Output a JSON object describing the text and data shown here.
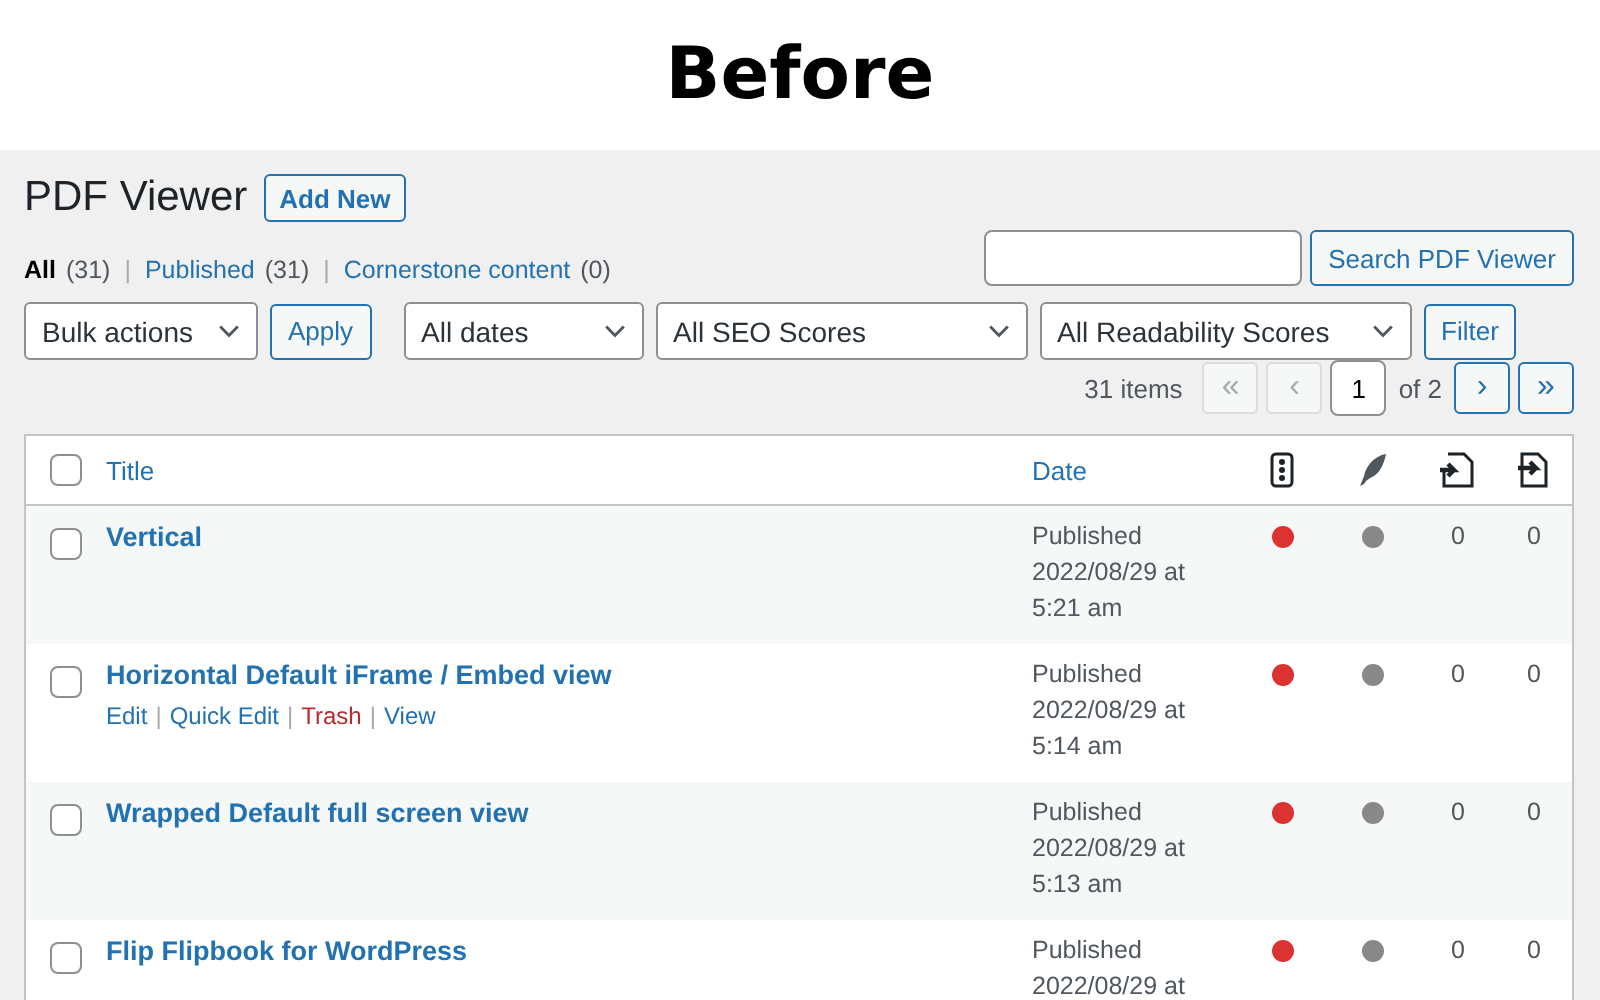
{
  "banner": {
    "title": "Before"
  },
  "page": {
    "title": "PDF Viewer",
    "add_new": "Add New"
  },
  "views_separator": "|",
  "views": [
    {
      "label": "All",
      "count": "(31)",
      "selected": true
    },
    {
      "label": "Published",
      "count": "(31)",
      "selected": false
    },
    {
      "label": "Cornerstone content",
      "count": "(0)",
      "selected": false
    }
  ],
  "search": {
    "button": "Search PDF Viewer"
  },
  "filters": {
    "bulk": "Bulk actions",
    "apply": "Apply",
    "dates": "All dates",
    "seo": "All SEO Scores",
    "readability": "All Readability Scores",
    "filter": "Filter"
  },
  "pagination": {
    "items": "31 items",
    "first": "«",
    "prev": "‹",
    "current": "1",
    "of": "of 2",
    "next": "›",
    "last": "»"
  },
  "table": {
    "select_all": {
      "checked": false
    },
    "columns": {
      "title": "Title",
      "date": "Date"
    },
    "actions_separator": "|",
    "rows": [
      {
        "title": "Vertical",
        "status": "Published",
        "date": "2022/08/29 at",
        "time": "5:21 am",
        "seo_score": {
          "color": "#dc3232"
        },
        "readability_score": {
          "color": "#888888"
        },
        "links": "0",
        "linked": "0",
        "checked": false
      },
      {
        "title": "Horizontal Default iFrame / Embed view",
        "status": "Published",
        "date": "2022/08/29 at",
        "time": "5:14 am",
        "seo_score": {
          "color": "#dc3232"
        },
        "readability_score": {
          "color": "#888888"
        },
        "links": "0",
        "linked": "0",
        "checked": false,
        "actions": [
          {
            "label": "Edit",
            "kind": "normal"
          },
          {
            "label": "Quick Edit",
            "kind": "normal"
          },
          {
            "label": "Trash",
            "kind": "danger"
          },
          {
            "label": "View",
            "kind": "normal"
          }
        ]
      },
      {
        "title": "Wrapped Default full screen view",
        "status": "Published",
        "date": "2022/08/29 at",
        "time": "5:13 am",
        "seo_score": {
          "color": "#dc3232"
        },
        "readability_score": {
          "color": "#888888"
        },
        "links": "0",
        "linked": "0",
        "checked": false
      },
      {
        "title": "Flip Flipbook for WordPress",
        "status": "Published",
        "date": "2022/08/29 at",
        "seo_score": {
          "color": "#dc3232"
        },
        "readability_score": {
          "color": "#888888"
        },
        "links": "0",
        "linked": "0",
        "checked": false
      }
    ]
  }
}
